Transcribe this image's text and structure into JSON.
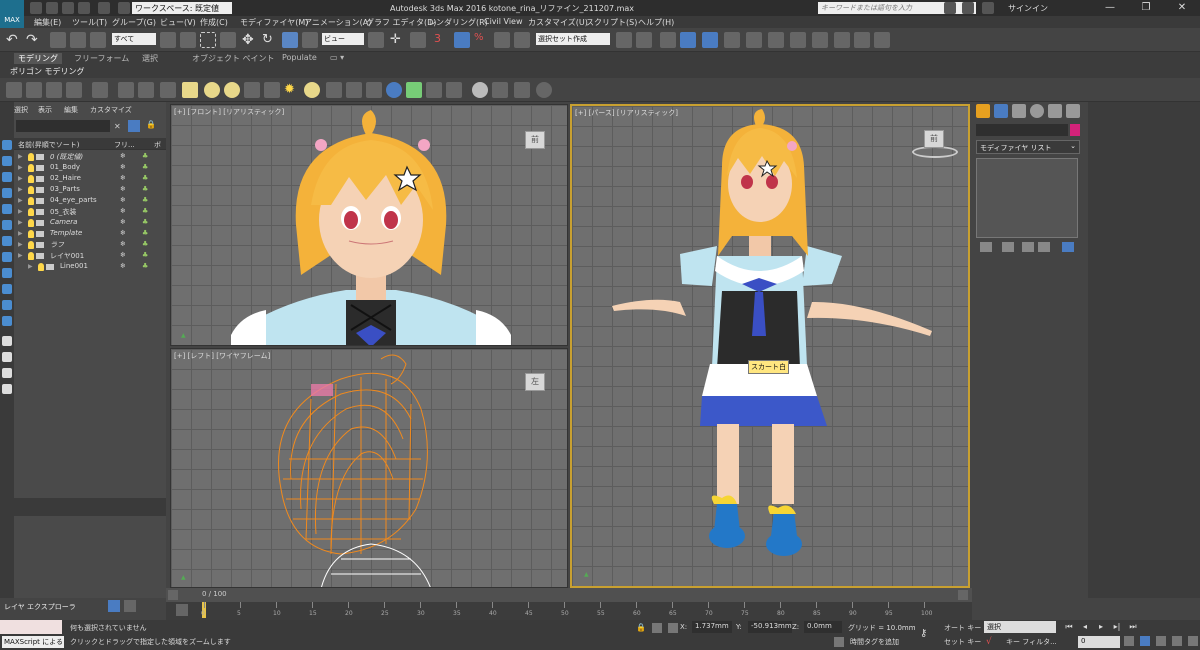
{
  "app": {
    "logo_text": "MAX",
    "title": "Autodesk 3ds Max 2016    kotone_rina_リファイン_211207.max",
    "workspace_label": "ワークスペース: 既定値",
    "search_placeholder": "キーワードまたは語句を入力",
    "signin": "サインイン"
  },
  "menu": [
    "編集(E)",
    "ツール(T)",
    "グループ(G)",
    "ビュー(V)",
    "作成(C)",
    "モディファイヤ(M)",
    "アニメーション(A)",
    "グラフ エディタ(D)",
    "レンダリング(R)",
    "Civil View",
    "カスタマイズ(U)",
    "スクリプト(S)",
    "ヘルプ(H)"
  ],
  "toolbar": {
    "filter_select": "すべて",
    "view_select": "ビュー",
    "selection_set": "選択セット作成",
    "num_label": "3"
  },
  "ribbon": {
    "tabs": [
      "モデリング",
      "フリーフォーム",
      "選択",
      "オブジェクト ペイント",
      "Populate"
    ],
    "active_tab": "モデリング",
    "sub_label": "ポリゴン モデリング"
  },
  "explorer": {
    "menu": [
      "選択",
      "表示",
      "編集",
      "カスタマイズ"
    ],
    "header_name": "名前(昇順でソート)",
    "header_freeze": "フリ...",
    "header_render": "ボ",
    "rows": [
      {
        "name": "0 (既定値)",
        "italic": true,
        "indent": 0
      },
      {
        "name": "01_Body",
        "italic": false,
        "indent": 0
      },
      {
        "name": "02_Haire",
        "italic": false,
        "indent": 0
      },
      {
        "name": "03_Parts",
        "italic": false,
        "indent": 0
      },
      {
        "name": "04_eye_parts",
        "italic": false,
        "indent": 0
      },
      {
        "name": "05_衣装",
        "italic": false,
        "indent": 0
      },
      {
        "name": "Camera",
        "italic": true,
        "indent": 0
      },
      {
        "name": "Template",
        "italic": true,
        "indent": 0
      },
      {
        "name": "ラフ",
        "italic": true,
        "indent": 0
      },
      {
        "name": "レイヤ001",
        "italic": false,
        "indent": 0
      },
      {
        "name": "Line001",
        "italic": false,
        "indent": 1
      }
    ],
    "bottom_label": "レイヤ エクスプローラ"
  },
  "viewports": {
    "front": {
      "label": "[+] [フロント] [リアリスティック]",
      "cube": "前"
    },
    "left": {
      "label": "[+] [レフト] [ワイヤフレーム]",
      "cube": "左"
    },
    "persp": {
      "label": "[+] [パース] [リアリスティック]",
      "cube": "前",
      "tooltip": "スカート白"
    }
  },
  "command_panel": {
    "modifier_list": "モディファイヤ リスト",
    "color": "#d4237a"
  },
  "timeline": {
    "frame_label": "0 / 100",
    "ticks": [
      0,
      5,
      10,
      15,
      20,
      25,
      30,
      35,
      40,
      45,
      50,
      55,
      60,
      65,
      70,
      75,
      80,
      85,
      90,
      95,
      100
    ]
  },
  "status": {
    "maxscript": "MAXScript による",
    "line1": "何も選択されていません",
    "line2": "クリックとドラッグで指定した領域をズームします",
    "x_label": "X:",
    "x_value": "1.737mm",
    "y_label": "Y:",
    "y_value": "-50.913mm",
    "z_label": "Z:",
    "z_value": "0.0mm",
    "grid": "グリッド = 10.0mm",
    "add_tag": "時間タグを追加",
    "auto_key": "オート キー",
    "set_key": "セット キー",
    "selection_dd": "選択",
    "key_filter": "キー フィルタ...",
    "frame_value": "0"
  }
}
